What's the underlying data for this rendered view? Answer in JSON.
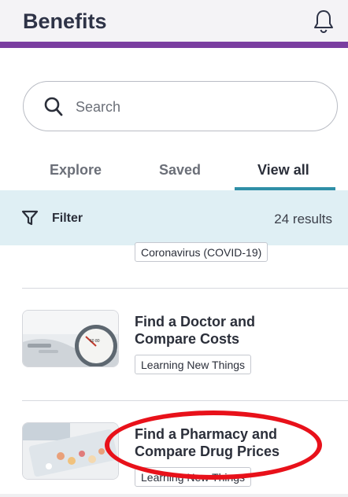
{
  "header": {
    "title": "Benefits",
    "notification_icon": "bell-icon"
  },
  "search": {
    "placeholder": "Search",
    "value": ""
  },
  "tabs": [
    {
      "label": "Explore",
      "active": false
    },
    {
      "label": "Saved",
      "active": false
    },
    {
      "label": "View all",
      "active": true
    }
  ],
  "filter": {
    "label": "Filter",
    "results": "24 results"
  },
  "items": [
    {
      "title": "",
      "tag": "Coronavirus (COVID-19)"
    },
    {
      "title_line1": "Find a Doctor and",
      "title_line2": "Compare Costs",
      "tag": "Learning New Things"
    },
    {
      "title_line1": "Find a Pharmacy and",
      "title_line2": "Compare Drug Prices",
      "tag": "Learning New Things"
    }
  ],
  "colors": {
    "brand_purple": "#7a3ea0",
    "accent_teal": "#2f8fa7",
    "filter_bg": "#dfeff4",
    "annotation_red": "#e8111a"
  }
}
